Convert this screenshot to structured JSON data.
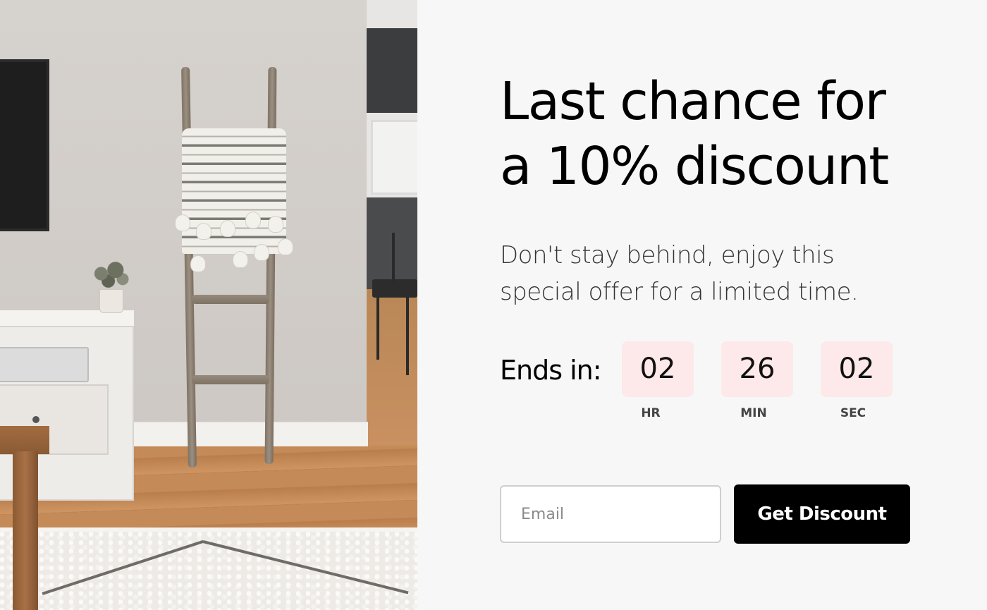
{
  "promo": {
    "headline_line1": "Last chance for",
    "headline_line2": "a 10% discount",
    "subtext_line1": "Don't stay behind, enjoy this",
    "subtext_line2": "special offer for a limited time."
  },
  "countdown": {
    "label": "Ends in:",
    "hours": "02",
    "minutes": "26",
    "seconds": "02",
    "hours_unit": "HR",
    "minutes_unit": "MIN",
    "seconds_unit": "SEC",
    "box_color": "#fde9ea"
  },
  "form": {
    "email_placeholder": "Email",
    "email_value": "",
    "submit_label": "Get Discount"
  },
  "image": {
    "alt_name": "living-room-photo"
  }
}
